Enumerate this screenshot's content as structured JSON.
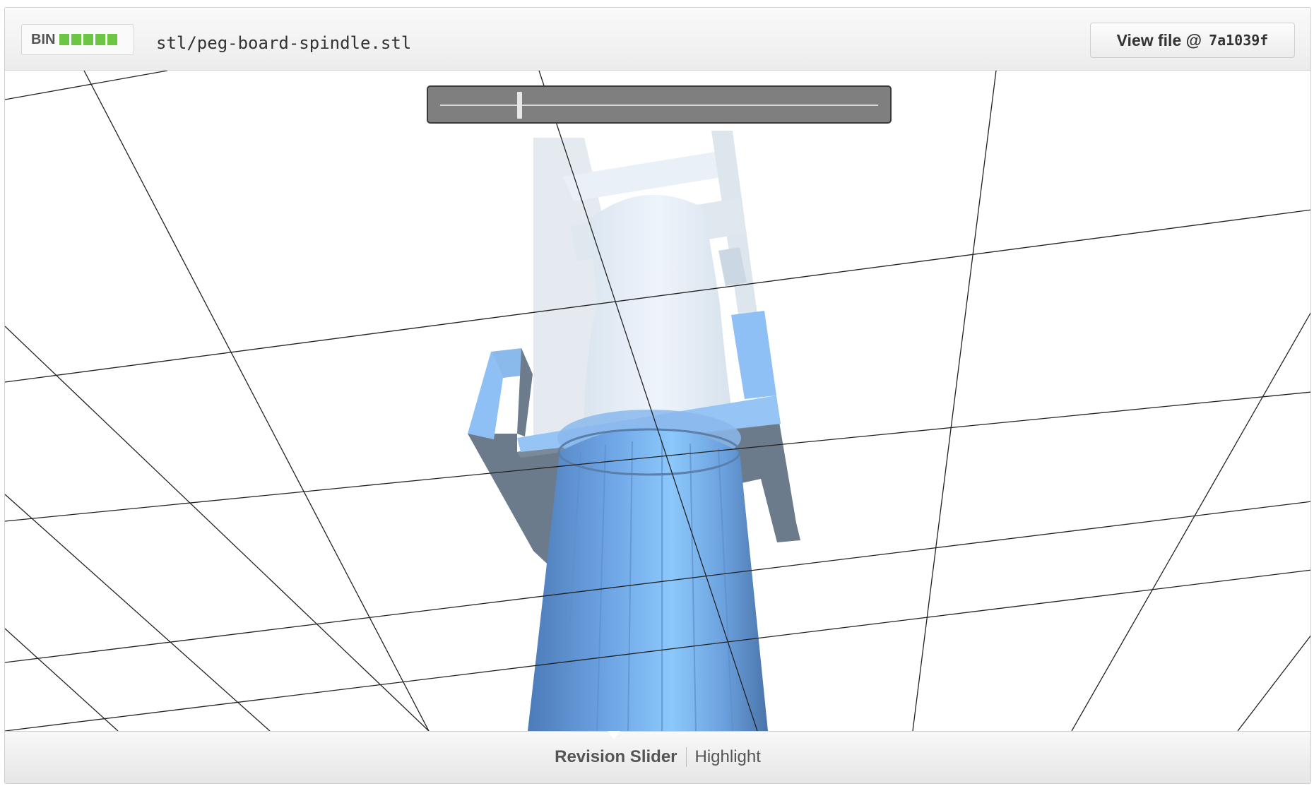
{
  "header": {
    "badge_label": "BIN",
    "badge_blocks": 5,
    "badge_color": "#6cc644",
    "file_path": "stl/peg-board-spindle.stl",
    "view_file_label": "View file @",
    "commit_sha": "7a1039f"
  },
  "viewer": {
    "revision_slider_value": 0.18,
    "model_colors": {
      "current": "#7fb6f2",
      "previous": "#dfe8f2",
      "shadow": "#6e7f8f"
    }
  },
  "footer": {
    "tabs": [
      {
        "label": "Revision Slider",
        "active": true
      },
      {
        "label": "Highlight",
        "active": false
      }
    ]
  }
}
